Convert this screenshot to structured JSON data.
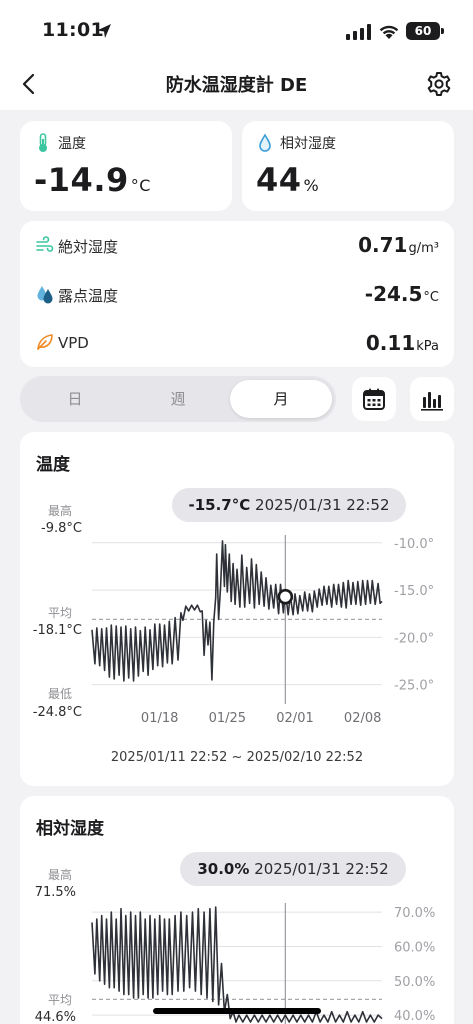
{
  "status": {
    "time": "11:01",
    "battery": "60"
  },
  "nav": {
    "title": "防水温湿度計 DE"
  },
  "temperature": {
    "label": "温度",
    "value": "-14.9",
    "unit": "°C"
  },
  "humidity": {
    "label": "相対湿度",
    "value": "44",
    "unit": "%"
  },
  "details": [
    {
      "label": "絶対湿度",
      "value": "0.71",
      "unit": "g/m³"
    },
    {
      "label": "露点温度",
      "value": "-24.5",
      "unit": "°C"
    },
    {
      "label": "VPD",
      "value": "0.11",
      "unit": "kPa"
    }
  ],
  "tabs": {
    "day": "日",
    "week": "週",
    "month": "月",
    "selected": "月"
  },
  "temp_chart": {
    "title": "温度",
    "tooltip_value": "-15.7°C",
    "tooltip_time": "2025/01/31 22:52",
    "max_label": "最高",
    "max_value": "-9.8°C",
    "avg_label": "平均",
    "avg_value": "-18.1°C",
    "min_label": "最低",
    "min_value": "-24.8°C",
    "range": "2025/01/11 22:52 ~ 2025/02/10 22:52"
  },
  "hum_chart": {
    "title": "相対湿度",
    "tooltip_value": "30.0%",
    "tooltip_time": "2025/01/31 22:52",
    "max_label": "最高",
    "max_value": "71.5%",
    "avg_label": "平均",
    "avg_value": "44.6%"
  },
  "chart_data": [
    {
      "type": "line",
      "title": "温度",
      "x_ticks": [
        "01/18",
        "01/25",
        "02/01",
        "02/08"
      ],
      "y_ticks": [
        "-10.0°",
        "-15.0°",
        "-20.0°",
        "-25.0°"
      ],
      "ylim": [
        -26.2,
        -9.6
      ],
      "xlim": [
        "2025/01/11 22:52",
        "2025/02/10 22:52"
      ],
      "average": -18.1,
      "selected": {
        "x": "2025/01/31 22:52",
        "y": -15.7
      },
      "series": [
        {
          "points": [
            [
              0,
              -19.2
            ],
            [
              0.3,
              -22.8
            ],
            [
              0.5,
              -19.0
            ],
            [
              0.8,
              -23.0
            ],
            [
              1.0,
              -19.1
            ],
            [
              1.3,
              -23.5
            ],
            [
              1.5,
              -19.0
            ],
            [
              1.8,
              -24.2
            ],
            [
              2.0,
              -18.7
            ],
            [
              2.3,
              -24.4
            ],
            [
              2.5,
              -18.8
            ],
            [
              2.8,
              -24.0
            ],
            [
              3.0,
              -18.9
            ],
            [
              3.3,
              -24.6
            ],
            [
              3.5,
              -18.8
            ],
            [
              3.8,
              -24.3
            ],
            [
              4.0,
              -19.1
            ],
            [
              4.3,
              -24.6
            ],
            [
              4.5,
              -18.9
            ],
            [
              4.8,
              -24.1
            ],
            [
              5.0,
              -19.3
            ],
            [
              5.3,
              -23.6
            ],
            [
              5.5,
              -18.9
            ],
            [
              5.8,
              -24.0
            ],
            [
              6.0,
              -19.2
            ],
            [
              6.3,
              -23.4
            ],
            [
              6.5,
              -18.6
            ],
            [
              6.8,
              -23.0
            ],
            [
              7.0,
              -18.6
            ],
            [
              7.3,
              -23.1
            ],
            [
              7.5,
              -18.7
            ],
            [
              7.8,
              -22.7
            ],
            [
              8.0,
              -18.3
            ],
            [
              8.3,
              -22.8
            ],
            [
              8.6,
              -17.9
            ],
            [
              8.9,
              -22.4
            ],
            [
              9.2,
              -17.4
            ],
            [
              9.4,
              -18.2
            ],
            [
              9.7,
              -16.7
            ],
            [
              10.0,
              -17.2
            ],
            [
              10.3,
              -16.6
            ],
            [
              10.6,
              -17.1
            ],
            [
              10.9,
              -16.6
            ],
            [
              11.2,
              -17.3
            ],
            [
              11.4,
              -17.2
            ],
            [
              11.6,
              -21.9
            ],
            [
              11.8,
              -18.2
            ],
            [
              12.0,
              -20.8
            ],
            [
              12.2,
              -18.4
            ],
            [
              12.4,
              -24.5
            ],
            [
              12.6,
              -18.3
            ],
            [
              12.8,
              -15.8
            ],
            [
              12.9,
              -11.2
            ],
            [
              13.1,
              -18.1
            ],
            [
              13.3,
              -14.6
            ],
            [
              13.5,
              -9.8
            ],
            [
              13.7,
              -14.6
            ],
            [
              13.8,
              -10.2
            ],
            [
              14.0,
              -15.2
            ],
            [
              14.2,
              -11.2
            ],
            [
              14.4,
              -16.2
            ],
            [
              14.6,
              -12.2
            ],
            [
              14.8,
              -16.5
            ],
            [
              15.0,
              -12.8
            ],
            [
              15.3,
              -16.8
            ],
            [
              15.5,
              -11.3
            ],
            [
              15.8,
              -16.8
            ],
            [
              16.0,
              -12.6
            ],
            [
              16.3,
              -16.4
            ],
            [
              16.5,
              -11.7
            ],
            [
              16.8,
              -16.9
            ],
            [
              17.0,
              -12.3
            ],
            [
              17.3,
              -16.5
            ],
            [
              17.5,
              -13.1
            ],
            [
              17.8,
              -16.7
            ],
            [
              18.0,
              -13.7
            ],
            [
              18.3,
              -17.0
            ],
            [
              18.5,
              -14.5
            ],
            [
              18.8,
              -16.9
            ],
            [
              19.0,
              -14.4
            ],
            [
              19.3,
              -17.5
            ],
            [
              19.5,
              -14.4
            ],
            [
              19.8,
              -17.4
            ],
            [
              20.0,
              -15.1
            ],
            [
              20.3,
              -17.6
            ],
            [
              20.5,
              -15.6
            ],
            [
              20.8,
              -17.6
            ],
            [
              21.0,
              -15.4
            ],
            [
              21.3,
              -17.5
            ],
            [
              21.5,
              -15.6
            ],
            [
              21.8,
              -17.2
            ],
            [
              22.0,
              -15.2
            ],
            [
              22.3,
              -17.2
            ],
            [
              22.5,
              -15.4
            ],
            [
              22.8,
              -17.3
            ],
            [
              23.0,
              -15.1
            ],
            [
              23.3,
              -16.8
            ],
            [
              23.5,
              -14.9
            ],
            [
              23.8,
              -16.6
            ],
            [
              24.0,
              -14.6
            ],
            [
              24.3,
              -16.5
            ],
            [
              24.5,
              -14.6
            ],
            [
              24.8,
              -16.8
            ],
            [
              25.0,
              -14.4
            ],
            [
              25.3,
              -16.5
            ],
            [
              25.5,
              -14.4
            ],
            [
              25.8,
              -16.8
            ],
            [
              26.0,
              -14.2
            ],
            [
              26.3,
              -16.9
            ],
            [
              26.5,
              -14.0
            ],
            [
              26.8,
              -16.5
            ],
            [
              27.0,
              -14.2
            ],
            [
              27.3,
              -16.5
            ],
            [
              27.5,
              -14.1
            ],
            [
              27.8,
              -16.6
            ],
            [
              28.0,
              -14.0
            ],
            [
              28.3,
              -16.5
            ],
            [
              28.5,
              -14.0
            ],
            [
              28.8,
              -16.4
            ],
            [
              29.0,
              -14.0
            ],
            [
              29.3,
              -16.5
            ],
            [
              29.6,
              -14.3
            ],
            [
              29.8,
              -16.4
            ],
            [
              30.0,
              -16.2
            ]
          ]
        }
      ]
    },
    {
      "type": "line",
      "title": "相対湿度",
      "y_ticks": [
        "70.0%",
        "60.0%",
        "50.0%",
        "40.0%"
      ],
      "ylim": [
        38,
        71.5
      ],
      "average": 44.6,
      "selected": {
        "x": "2025/01/31 22:52",
        "y": 30.0
      },
      "series": [
        {
          "points": [
            [
              0,
              67
            ],
            [
              0.3,
              52
            ],
            [
              0.5,
              68
            ],
            [
              0.8,
              50
            ],
            [
              1.0,
              69
            ],
            [
              1.3,
              49
            ],
            [
              1.5,
              68
            ],
            [
              1.8,
              48
            ],
            [
              2.0,
              70
            ],
            [
              2.3,
              48
            ],
            [
              2.5,
              68
            ],
            [
              2.8,
              47
            ],
            [
              3.0,
              71
            ],
            [
              3.3,
              46
            ],
            [
              3.5,
              69
            ],
            [
              3.8,
              46
            ],
            [
              4.0,
              70
            ],
            [
              4.3,
              45
            ],
            [
              4.5,
              69
            ],
            [
              4.8,
              45
            ],
            [
              5.0,
              70
            ],
            [
              5.3,
              46
            ],
            [
              5.5,
              68
            ],
            [
              5.8,
              45
            ],
            [
              6.0,
              69
            ],
            [
              6.3,
              45
            ],
            [
              6.5,
              68
            ],
            [
              6.8,
              46
            ],
            [
              7.0,
              69
            ],
            [
              7.3,
              47
            ],
            [
              7.5,
              68
            ],
            [
              7.8,
              46
            ],
            [
              8.0,
              68
            ],
            [
              8.3,
              46
            ],
            [
              8.6,
              69
            ],
            [
              8.9,
              47
            ],
            [
              9.2,
              70
            ],
            [
              9.5,
              47
            ],
            [
              9.8,
              69
            ],
            [
              10.1,
              48
            ],
            [
              10.4,
              70
            ],
            [
              10.7,
              47
            ],
            [
              11.0,
              71
            ],
            [
              11.3,
              46
            ],
            [
              11.6,
              70
            ],
            [
              11.9,
              45
            ],
            [
              12.2,
              71
            ],
            [
              12.5,
              44
            ],
            [
              12.8,
              71.5
            ],
            [
              13.1,
              43
            ],
            [
              13.4,
              55
            ],
            [
              13.7,
              41
            ],
            [
              14.0,
              46
            ],
            [
              14.3,
              39
            ],
            [
              14.6,
              41
            ],
            [
              14.9,
              38
            ],
            [
              15.2,
              40
            ],
            [
              15.6,
              38
            ],
            [
              16.0,
              40
            ],
            [
              16.4,
              38
            ],
            [
              16.8,
              40
            ],
            [
              17.2,
              38
            ],
            [
              17.6,
              40
            ],
            [
              18.0,
              38
            ],
            [
              18.4,
              40
            ],
            [
              18.8,
              38
            ],
            [
              19.2,
              40
            ],
            [
              19.6,
              38
            ],
            [
              20.0,
              40
            ],
            [
              20.4,
              38
            ],
            [
              20.8,
              40
            ],
            [
              21.2,
              38
            ],
            [
              21.6,
              40
            ],
            [
              22.0,
              38
            ],
            [
              22.4,
              40
            ],
            [
              22.8,
              38
            ],
            [
              23.2,
              41
            ],
            [
              23.6,
              38
            ],
            [
              24.0,
              40
            ],
            [
              24.4,
              38
            ],
            [
              24.8,
              41
            ],
            [
              25.2,
              38
            ],
            [
              25.6,
              40
            ],
            [
              26.0,
              38
            ],
            [
              26.4,
              41
            ],
            [
              26.8,
              38
            ],
            [
              27.2,
              40
            ],
            [
              27.6,
              38
            ],
            [
              28.0,
              41
            ],
            [
              28.4,
              38
            ],
            [
              28.8,
              40
            ],
            [
              29.2,
              38
            ],
            [
              29.6,
              40
            ],
            [
              30.0,
              39
            ]
          ]
        }
      ]
    }
  ]
}
